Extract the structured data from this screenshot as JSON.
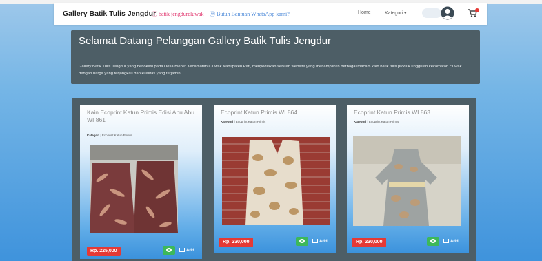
{
  "navbar": {
    "brand": "Gallery Batik Tulis Jengdur",
    "instagram": "ⓘ batik jengdurcluwak",
    "whatsapp": "ⓦ Butuh Bantuan WhatsApp kami?",
    "nav_home": "Home",
    "nav_kategori": "Kategori ▾"
  },
  "jumbotron": {
    "title": "Selamat Datang Pelanggan Gallery Batik Tulis Jengdur",
    "text": "Gallery Batik Tulis Jengdur yang berlokasi pada Desa Bleber Kecamatan Cluwak Kabupaten Pati, menyediakan sebuah website yang menampilkan berbagai macam kain batik tulis produk unggulan kecamatan cluwak dengan harga yang terjangkau dan kualitas yang terjamin."
  },
  "products": [
    {
      "title": "Kain Ecoprint Katun Primis Edisi Abu Abu WI 861",
      "kategori_label": "Kategori",
      "kategori_value": " | Ecoprint Katun Primis",
      "price": "Rp. 225,000",
      "add_label": "Add"
    },
    {
      "title": "Ecoprint Katun Primis WI 864",
      "kategori_label": "Kategori",
      "kategori_value": " | Ecoprint Katun Primis",
      "price": "Rp. 230,000",
      "add_label": "Add"
    },
    {
      "title": "Ecoprint Katun Primis WI 863",
      "kategori_label": "Kategori",
      "kategori_value": " | Ecoprint Katun Primis",
      "price": "Rp. 230,000",
      "add_label": "Add"
    }
  ],
  "icons": {
    "avatar": "avatar-icon",
    "cart": "cart-icon",
    "view": "eye-icon",
    "add": "cart-add-icon"
  },
  "colors": {
    "price_badge": "#e53935",
    "view_button": "#3db85a",
    "panel": "#4d5e66"
  }
}
